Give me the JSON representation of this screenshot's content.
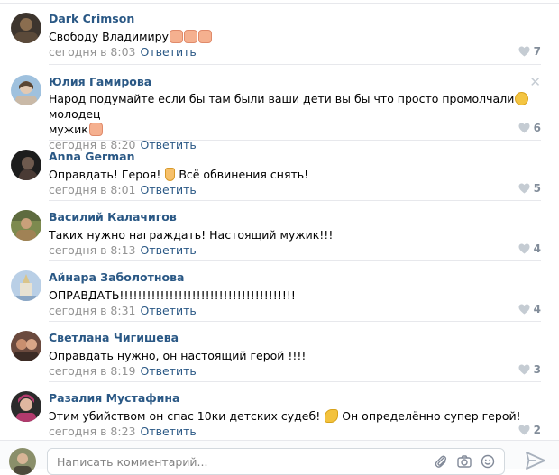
{
  "comments": [
    {
      "author": "Dark Crimson",
      "text": "Свободу Владимиру",
      "emoji": [
        "hand",
        "hand",
        "hand"
      ],
      "time": "сегодня в 8:03",
      "reply": "Ответить",
      "likes": "7",
      "avatar_colors": [
        "#5b4a3a",
        "#8a6d4f"
      ]
    },
    {
      "author": "Юлия Гамирова",
      "text": "Народ подумайте если бы там были ваши дети вы бы что просто промолчали",
      "emoji_inline": "flushed",
      "text2": "молодец",
      "text3": "мужик",
      "emoji": [
        "hand"
      ],
      "time": "сегодня в 8:20",
      "reply": "Ответить",
      "likes": "6",
      "avatar_colors": [
        "#7fa7c9",
        "#c9b9a7"
      ]
    },
    {
      "author": "Anna German",
      "text": "Оправдать! Героя!",
      "emoji_inline": "point",
      "text2": "Всё обвинения снять!",
      "time": "сегодня в 8:01",
      "reply": "Ответить",
      "likes": "5",
      "avatar_colors": [
        "#1d1d1d",
        "#4a3b35"
      ]
    },
    {
      "author": "Василий Калачигов",
      "text": "Таких нужно награждать! Настоящий мужик!!!",
      "time": "сегодня в 8:13",
      "reply": "Ответить",
      "likes": "4",
      "avatar_colors": [
        "#5e6b3f",
        "#a08255"
      ]
    },
    {
      "author": "Айнара Заболотнова",
      "text": "ОПРАВДАТЬ!!!!!!!!!!!!!!!!!!!!!!!!!!!!!!!!!!!!!!!",
      "time": "сегодня в 8:31",
      "reply": "Ответить",
      "likes": "4",
      "avatar_colors": [
        "#9cb7d6",
        "#d9c48a"
      ]
    },
    {
      "author": "Светлана Чигишева",
      "text": "Оправдать нужно, он настоящий герой !!!!",
      "time": "сегодня в 8:19",
      "reply": "Ответить",
      "likes": "3",
      "avatar_colors": [
        "#6b4a3e",
        "#c98f6f"
      ]
    },
    {
      "author": "Разалия Мустафина",
      "text": "Этим убийством он спас 10ки детских судеб!",
      "emoji_inline": "muscle",
      "text2": "Он определённо супер герой!",
      "time": "сегодня в 8:23",
      "reply": "Ответить",
      "likes": "2",
      "avatar_colors": [
        "#b23a6d",
        "#2b2b2b"
      ]
    }
  ],
  "composer": {
    "placeholder": "Написать комментарий..."
  },
  "icons": {
    "like": "heart-icon",
    "close": "close-icon",
    "attach": "paperclip-icon",
    "camera": "camera-icon",
    "emoji": "smile-icon",
    "send": "send-icon"
  },
  "colors": {
    "link": "#2a5885",
    "meta": "#939393",
    "like": "#818c99"
  }
}
